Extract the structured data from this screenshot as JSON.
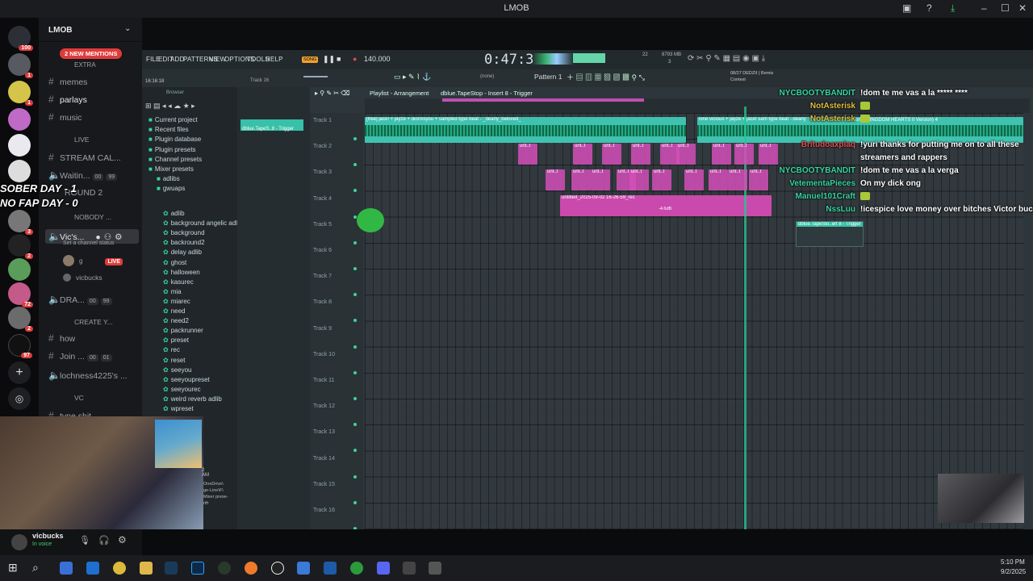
{
  "window": {
    "title": "LMOB"
  },
  "discord": {
    "server_name": "LMOB",
    "mentions_pill": "2 NEW MENTIONS",
    "server_badges": [
      "100",
      "1",
      "1",
      "3",
      "3",
      "2",
      "72",
      "2",
      "97"
    ],
    "channels": {
      "extra": "EXTRA",
      "memes": "memes",
      "parlays": "parlays",
      "music": "music",
      "live": "LIVE",
      "stream_call": "STREAM CAL...",
      "waiting": "Waitin...",
      "waiting_a": "00",
      "waiting_b": "99",
      "round2": "ROUND 2",
      "nobody": "NOBODY ...",
      "vics": "Vic's...",
      "vics_status": "Set a channel status",
      "live_badge": "LIVE",
      "member_g": "g",
      "member_vicbucks": "vicbucks",
      "dra": "DRA...",
      "dra_a": "00",
      "dra_b": "99",
      "create": "CREATE Y...",
      "how": "how",
      "join": "Join ...",
      "join_a": "00",
      "join_b": "01",
      "lochness": "lochness4225's ...",
      "vc": "VC",
      "type_shit": "type shit"
    },
    "overlay": {
      "line1": "SOBER DAY - 1",
      "line2": "NO FAP DAY - 0"
    },
    "user": {
      "name": "vicbucks",
      "status": "In voice"
    }
  },
  "fl": {
    "menu": [
      "FILE",
      "EDIT",
      "ADD",
      "PATTERNS",
      "VIEW",
      "OPTIONS",
      "TOOLS",
      "HELP"
    ],
    "song_badge": "SONG",
    "tempo": "140.000",
    "time": "0:47:34",
    "cpu": "22",
    "mem": "8793 MB",
    "mem2": "3",
    "hint_time": "16:16:18",
    "hint_track": "Track 16",
    "pattern": "Pattern 1",
    "none": "(none)",
    "news1": "08/27  DEDZII | Remix",
    "news2": "Contest",
    "playlist_title": "Playlist - Arrangement",
    "playlist_path": "dblue.TapeStop - Insert 8 - Trigger",
    "channel_clip": "dblue.TapeS..8 - Trigger",
    "browser_label": "Browser",
    "browser": [
      {
        "label": "Current project",
        "icon": "■"
      },
      {
        "label": "Recent files",
        "icon": "■"
      },
      {
        "label": "Plugin database",
        "icon": "■"
      },
      {
        "label": "Plugin presets",
        "icon": "■"
      },
      {
        "label": "Channel presets",
        "icon": "■"
      },
      {
        "label": "Mixer presets",
        "icon": "■"
      },
      {
        "label": "adlibs",
        "icon": "■"
      },
      {
        "label": "gwuaps",
        "icon": "■"
      }
    ],
    "presets": [
      "adlib",
      "background angelic adlib",
      "background",
      "backround2",
      "delay adlib",
      "ghost",
      "halloween",
      "kasurec",
      "mia",
      "miarec",
      "need",
      "need2",
      "packrunner",
      "preset",
      "rec",
      "reset",
      "seeyou",
      "seeyoupreset",
      "seeyourec",
      "weird reverb adlib",
      "wpreset"
    ],
    "tracks": [
      "Track 1",
      "Track 2",
      "Track 3",
      "Track 4",
      "Track 5",
      "Track 6",
      "Track 7",
      "Track 8",
      "Track 9",
      "Track 10",
      "Track 11",
      "Track 12",
      "Track 13",
      "Track 14",
      "Track 15",
      "Track 16"
    ],
    "clip1_label": "[free] jace! + jayze + dior/xsyou + sampled type beat - _dearly_beloved_",
    "clip2_label": "nine vicious + jayze + jace! sam  type beat - dearly",
    "clip3_label": "untitled_2025-09-02 16-26-59_rec",
    "clip4_label": "dblue.TapeSto..ert 8 - Trigger",
    "clip_gain": "-4.6dB",
    "unt": "unt..t",
    "kh_label": "ond (KINGDOM HEARTS II Version) 4",
    "bottom_text": "2 AM",
    "bottom_files": [
      "OneDrive\\",
      "ge-Line\\F\\",
      "Mixer prese-",
      "rift"
    ]
  },
  "chat": [
    {
      "user": "NYCBOOTYBANDIT",
      "color": "#37d7a0",
      "text": "!dom te me vas a la ***** ****"
    },
    {
      "user": "NotAsterisk",
      "color": "#e0c040",
      "text": ""
    },
    {
      "user": "NotAsterisk",
      "color": "#e0c040",
      "text": ""
    },
    {
      "user": "Britudoaxplaq",
      "color": "#e05050",
      "text": "!yuri thanks for putting me on to all these"
    },
    {
      "user": "",
      "color": "#ffffff",
      "text": "streamers and rappers"
    },
    {
      "user": "NYCBOOTYBANDIT",
      "color": "#37d7a0",
      "text": "!dom te me vas a la verga"
    },
    {
      "user": "VetementaPieces",
      "color": "#37d7a0",
      "text": "On my dick ong"
    },
    {
      "user": "Manuel101Craft",
      "color": "#37d7a0",
      "text": ""
    },
    {
      "user": "NssLuu",
      "color": "#37d7a0",
      "text": "!icespice love money over bitches Victor bucko"
    }
  ],
  "taskbar": {
    "time": "5:10 PM",
    "date": "9/2/2025"
  },
  "colors": {
    "accent": "#37d79a",
    "clip_teal": "#3fc2b0",
    "clip_pink": "#d34fb8",
    "chat_green": "#37d7a0"
  }
}
